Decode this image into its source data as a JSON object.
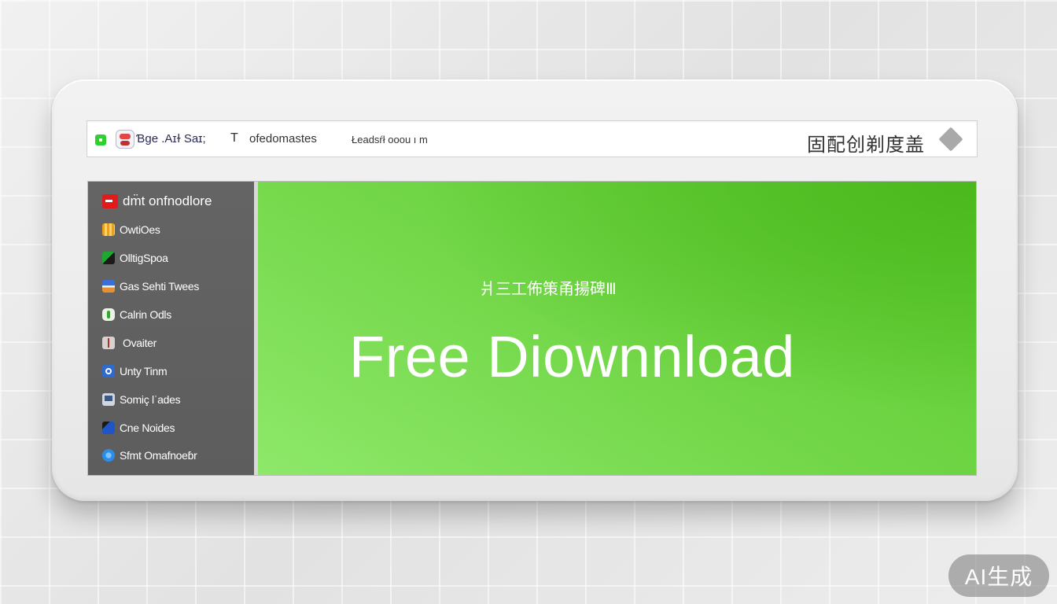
{
  "topbar": {
    "status_icon": "green-square-icon",
    "app_icon": "app-badge-icon",
    "title": "Ɓge .Aɪɫ Saɪ;",
    "tab1_icon_glyph": "T",
    "tab1_label": "ofedomastes",
    "tab2_label": "Łeadsŕł ooou ı m",
    "right_text": "固配创剃度盖",
    "menu_icon": "diamond-icon"
  },
  "sidebar": {
    "header": {
      "label": "dm̈t onfnodlore",
      "icon": "red-app-icon",
      "color": "#e11b1b"
    },
    "items": [
      {
        "label": "OwtiOes",
        "icon": "orange-grid-icon",
        "color": "#e8a020"
      },
      {
        "label": "OlltiɡSpoa",
        "icon": "green-black-flag-icon",
        "color": "#1fa82f"
      },
      {
        "label": "Gas Sehti Twees",
        "icon": "blue-orange-card-icon",
        "color": "#3b6fd8"
      },
      {
        "label": "Calrin Odls",
        "icon": "green-leaf-icon",
        "color": "#e9f5e2"
      },
      {
        "label": "Ovaiter",
        "icon": "gift-icon",
        "color": "#d9d0d0"
      },
      {
        "label": "Unty Tinm",
        "icon": "blue-circle-app-icon",
        "color": "#2f6ad0"
      },
      {
        "label": "Somiç lˈades",
        "icon": "monitor-icon",
        "color": "#cfd8e2"
      },
      {
        "label": "Cne Noides",
        "icon": "blue-pen-icon",
        "color": "#1e56c8"
      },
      {
        "label": "Sfmt Omafnoeɓr",
        "icon": "blue-dot-icon",
        "color": "#2c8de8"
      }
    ]
  },
  "hero": {
    "subtitle": "爿三工佈策甬揚碑Ⅲ",
    "title": "Free Diownnload",
    "accent": "#6bd43f"
  },
  "watermark": "AI生成"
}
